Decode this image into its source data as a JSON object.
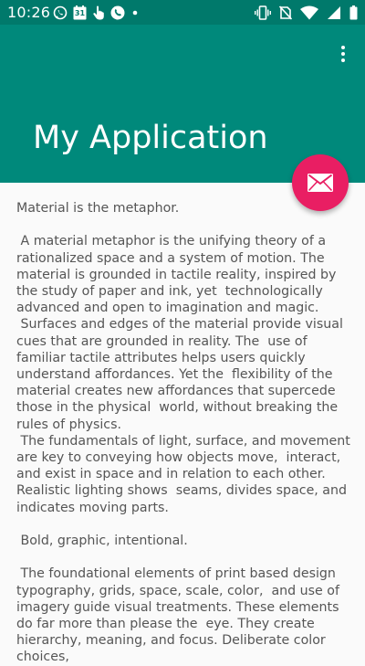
{
  "status_bar": {
    "time": "10:26",
    "left_icons": [
      "whatsapp-icon",
      "calendar-icon",
      "touch-icon",
      "phone-icon",
      "dot-icon"
    ],
    "calendar_day": "31",
    "right_icons": [
      "vibrate-icon",
      "no-sim-icon",
      "wifi-icon",
      "signal-icon",
      "battery-icon"
    ],
    "background": "#00796b"
  },
  "app_bar": {
    "title": "My Application",
    "background": "#00897b",
    "menu_icon": "overflow-menu-icon"
  },
  "fab": {
    "icon": "mail-icon",
    "color": "#e91e63"
  },
  "content": {
    "text": "Material is the metaphor.\n\n A material metaphor is the unifying theory of a rationalized space and a system of motion. The material is grounded in tactile reality, inspired by the study of paper and ink, yet  technologically advanced and open to imagination and magic.\n Surfaces and edges of the material provide visual cues that are grounded in reality. The  use of familiar tactile attributes helps users quickly understand affordances. Yet the  flexibility of the material creates new affordances that supercede those in the physical  world, without breaking the rules of physics.\n The fundamentals of light, surface, and movement are key to conveying how objects move,  interact, and exist in space and in relation to each other. Realistic lighting shows  seams, divides space, and indicates moving parts.\n\n Bold, graphic, intentional.\n\n The foundational elements of print based design typography, grids, space, scale, color,  and use of imagery guide visual treatments. These elements do far more than please the  eye. They create hierarchy, meaning, and focus. Deliberate color choices,",
    "color": "#555555"
  }
}
